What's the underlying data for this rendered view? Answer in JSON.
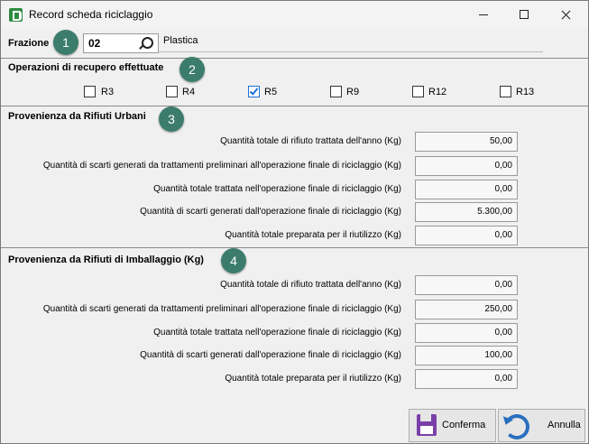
{
  "window": {
    "title": "Record scheda riciclaggio"
  },
  "header": {
    "frazione_label": "Frazione",
    "code_value": "02",
    "description_value": "Plastica"
  },
  "badges": [
    "1",
    "2",
    "3",
    "4"
  ],
  "operations": {
    "title": "Operazioni di recupero effettuate",
    "items": [
      {
        "label": "R3",
        "checked": false
      },
      {
        "label": "R4",
        "checked": false
      },
      {
        "label": "R5",
        "checked": true
      },
      {
        "label": "R9",
        "checked": false
      },
      {
        "label": "R12",
        "checked": false
      },
      {
        "label": "R13",
        "checked": false
      }
    ]
  },
  "urbani": {
    "title": "Provenienza da Rifiuti Urbani",
    "rows": [
      {
        "label": "Quantità totale di rifiuto trattata dell'anno (Kg)",
        "value": "50,00"
      },
      {
        "label": "Quantità di scarti generati da trattamenti preliminari all'operazione finale di riciclaggio (Kg)",
        "value": "0,00"
      },
      {
        "label": "Quantità totale trattata nell'operazione finale di riciclaggio (Kg)",
        "value": "0,00"
      },
      {
        "label": "Quantità di scarti generati dall'operazione finale di riciclaggio (Kg)",
        "value": "5.300,00"
      },
      {
        "label": "Quantità totale preparata per il riutilizzo (Kg)",
        "value": "0,00"
      }
    ]
  },
  "imballaggio": {
    "title": "Provenienza da Rifiuti di Imballaggio (Kg)",
    "rows": [
      {
        "label": "Quantità totale di rifiuto trattata dell'anno (Kg)",
        "value": "0,00"
      },
      {
        "label": "Quantità di scarti generati da trattamenti preliminari all'operazione finale di riciclaggio (Kg)",
        "value": "250,00"
      },
      {
        "label": "Quantità totale trattata nell'operazione finale di riciclaggio (Kg)",
        "value": "0,00"
      },
      {
        "label": "Quantità di scarti generati dall'operazione finale di riciclaggio (Kg)",
        "value": "100,00"
      },
      {
        "label": "Quantità totale preparata per il riutilizzo (Kg)",
        "value": "0,00"
      }
    ]
  },
  "footer": {
    "confirm_label": "Conferma",
    "cancel_label": "Annulla"
  },
  "icons": {
    "app": "app-logo-icon",
    "search": "search-icon",
    "save": "floppy-disk-icon",
    "cancel": "undo-icon"
  },
  "colors": {
    "badge": "#3c7c6c",
    "checkbox_checked": "#1f6fd8",
    "save_icon": "#7b3fa8",
    "undo_icon": "#2a6fbf"
  }
}
